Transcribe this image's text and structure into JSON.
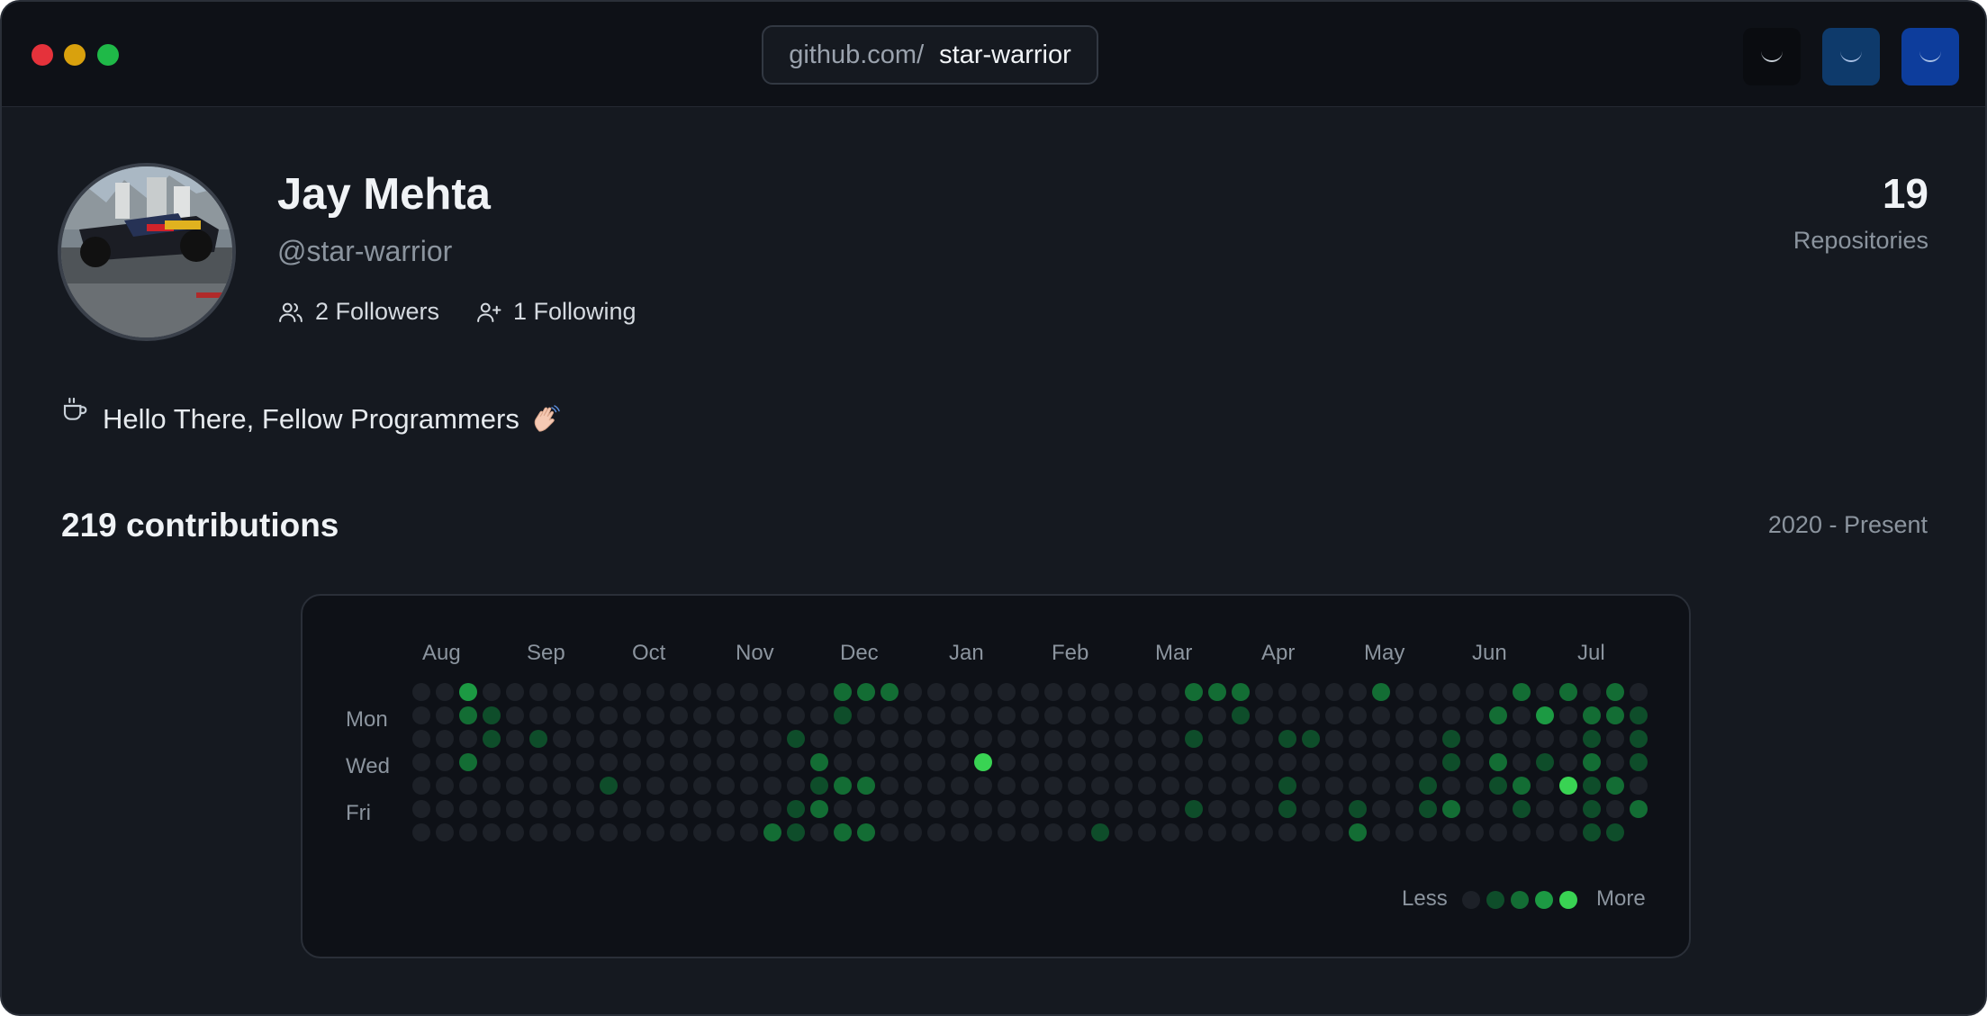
{
  "window": {
    "url_host": "github.com/",
    "url_path": "star-warrior"
  },
  "profile": {
    "name": "Jay Mehta",
    "handle": "@star-warrior",
    "followers_label": "2 Followers",
    "following_label": "1 Following",
    "repositories_count": "19",
    "repositories_label": "Repositories",
    "bio": "Hello There, Fellow Programmers",
    "bio_emoji": "waving-hand"
  },
  "contributions": {
    "title": "219 contributions",
    "range": "2020 - Present",
    "months": [
      "Aug",
      "Sep",
      "Oct",
      "Nov",
      "Dec",
      "Jan",
      "Feb",
      "Mar",
      "Apr",
      "May",
      "Jun",
      "Jul"
    ],
    "day_labels": [
      "Mon",
      "Wed",
      "Fri"
    ],
    "legend_less": "Less",
    "legend_more": "More",
    "level_colors": [
      "#1d2128",
      "#0e4d2a",
      "#136d34",
      "#1c9a43",
      "#39d353"
    ],
    "weeks": 53,
    "rows": [
      "00300000000000000022200000000000022200000200000202020",
      "00210000000000000010000000000000000100000000002030221",
      "00010100000000001000000000000000010001100000100000101",
      "00200000000000000200000060000000000000000000102010201",
      "00000000100000000122000000000000000001000001001205120",
      "00000000000000001200000000000000010001001001200100102",
      "00000000000000021022000000000100000000002000000000110"
    ]
  }
}
